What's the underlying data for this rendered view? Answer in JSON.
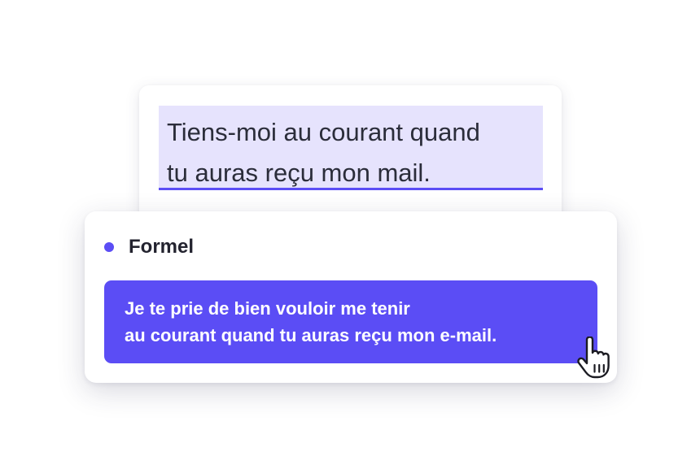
{
  "source": {
    "line1": "Tiens-moi au courant quand",
    "line2": "tu auras reçu mon mail."
  },
  "suggestion": {
    "style_label": "Formel",
    "line1": "Je te prie de bien vouloir me tenir",
    "line2": "au courant quand tu auras reçu mon e-mail."
  },
  "colors": {
    "accent": "#5b4df5",
    "highlight": "#e6e3fd",
    "text_dark": "#2b2d3a"
  },
  "icons": {
    "pointer": "hand-pointer-icon",
    "bullet": "dot-icon"
  }
}
